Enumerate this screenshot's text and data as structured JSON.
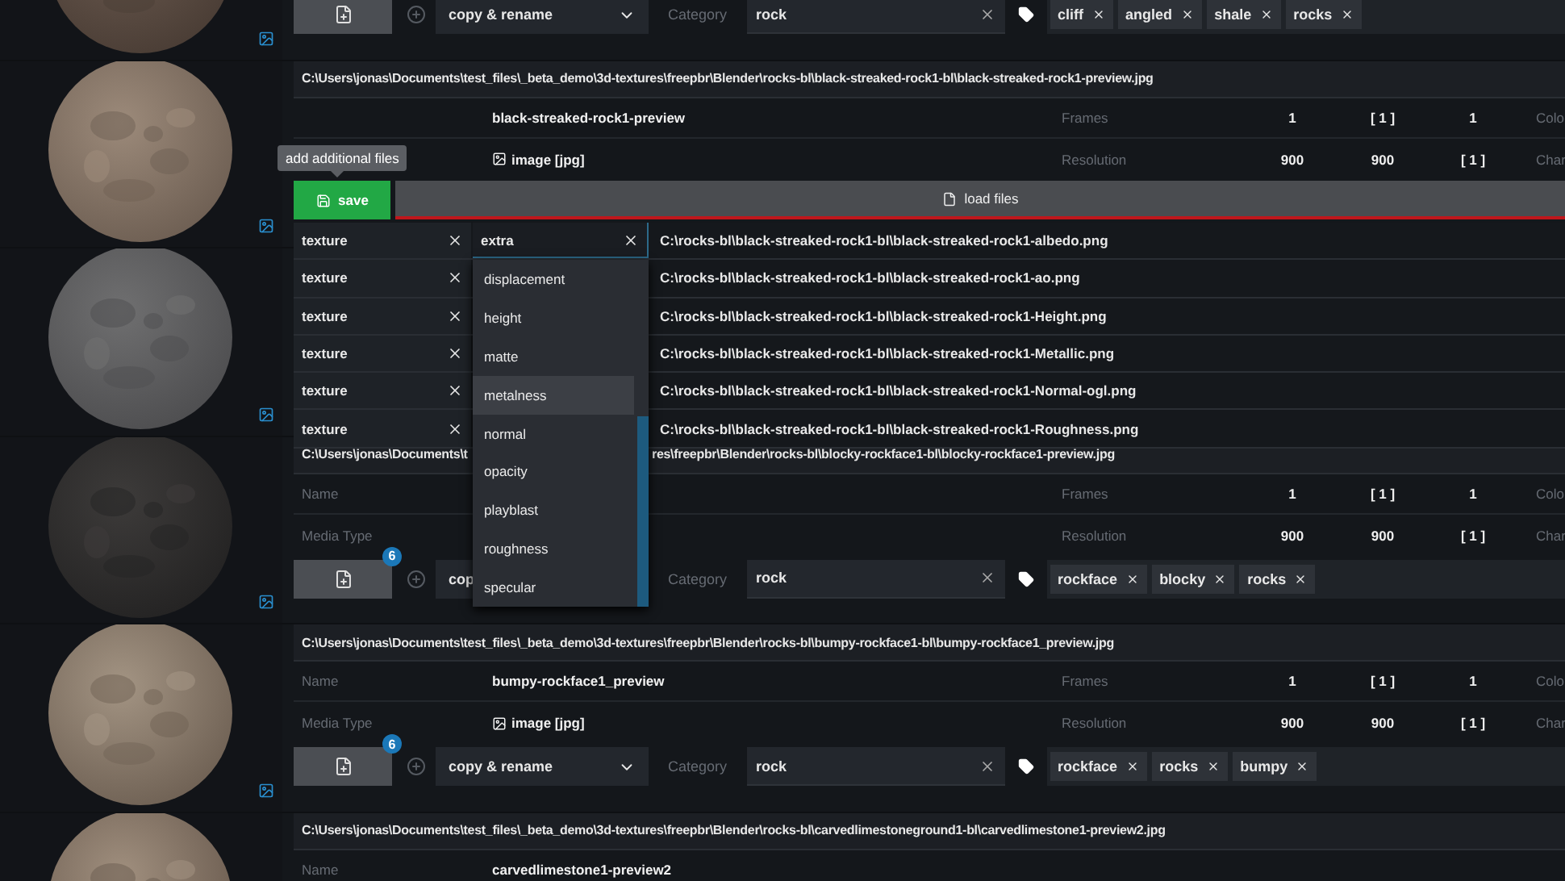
{
  "rows": [
    {
      "thumb_icon": true,
      "action_bar": {
        "mode": "copy & rename",
        "mode_chevron": true,
        "category_label": "Category",
        "category": "rock",
        "tags": [
          "cliff",
          "angled",
          "shale",
          "rocks"
        ]
      }
    },
    {
      "thumb_icon": true,
      "path": [
        "C:\\Users\\jonas\\Documents\\test_files\\_beta_demo\\3d-textures\\freepbr\\Blender\\rocks-bl\\black-streaked-rock1-bl\\black-streaked-rock1-preview.jpg"
      ],
      "name_value": "black-streaked-rock1-preview",
      "media_value": "image [jpg]",
      "frames_label": "Frames",
      "frames_values": [
        "1",
        "[ 1 ]",
        "1"
      ],
      "frames_extra": "Colo",
      "resolution_label": "Resolution",
      "resolution_values": [
        "900",
        "900",
        "[ 1 ]"
      ],
      "resolution_extra": "Char"
    },
    {
      "thumb_icon": true
    },
    {
      "thumb_icon": true,
      "path": [
        "C:\\Users\\jonas\\Documents\\t",
        "res\\freepbr\\Blender\\rocks-bl\\blocky-rockface1-bl\\blocky-rockface1-preview.jpg"
      ],
      "name_label": "Name",
      "media_label": "Media Type",
      "frames_label": "Frames",
      "frames_values": [
        "1",
        "[ 1 ]",
        "1"
      ],
      "frames_extra": "Colo",
      "resolution_label": "Resolution",
      "resolution_values": [
        "900",
        "900",
        "[ 1 ]"
      ],
      "resolution_extra": "Char",
      "action_bar": {
        "badge": "6",
        "mode": "cop",
        "category_label": "Category",
        "category": "rock",
        "tags": [
          "rockface",
          "blocky",
          "rocks"
        ]
      }
    },
    {
      "thumb_icon": true,
      "path": [
        "C:\\Users\\jonas\\Documents\\test_files\\_beta_demo\\3d-textures\\freepbr\\Blender\\rocks-bl\\bumpy-rockface1-bl\\bumpy-rockface1_preview.jpg"
      ],
      "name_label": "Name",
      "name_value": "bumpy-rockface1_preview",
      "media_label": "Media Type",
      "media_value": "image [jpg]",
      "frames_label": "Frames",
      "frames_values": [
        "1",
        "[ 1 ]",
        "1"
      ],
      "frames_extra": "Colo",
      "resolution_label": "Resolution",
      "resolution_values": [
        "900",
        "900",
        "[ 1 ]"
      ],
      "resolution_extra": "Char",
      "action_bar": {
        "badge": "6",
        "mode": "copy & rename",
        "mode_chevron": true,
        "category_label": "Category",
        "category": "rock",
        "tags": [
          "rockface",
          "rocks",
          "bumpy"
        ]
      }
    },
    {
      "path": [
        "C:\\Users\\jonas\\Documents\\test_files\\_beta_demo\\3d-textures\\freepbr\\Blender\\rocks-bl\\carvedlimestoneground1-bl\\carvedlimestone1-preview2.jpg"
      ],
      "name_label": "Name",
      "name_value": "carvedlimestone1-preview2"
    }
  ],
  "editor": {
    "tooltip": "add additional files",
    "save": "save",
    "load": "load files",
    "files": [
      {
        "role": "texture",
        "extra": "extra",
        "path": "C:\\rocks-bl\\black-streaked-rock1-bl\\black-streaked-rock1-albedo.png"
      },
      {
        "role": "texture",
        "path": "C:\\rocks-bl\\black-streaked-rock1-bl\\black-streaked-rock1-ao.png"
      },
      {
        "role": "texture",
        "path": "C:\\rocks-bl\\black-streaked-rock1-bl\\black-streaked-rock1-Height.png"
      },
      {
        "role": "texture",
        "path": "C:\\rocks-bl\\black-streaked-rock1-bl\\black-streaked-rock1-Metallic.png"
      },
      {
        "role": "texture",
        "path": "C:\\rocks-bl\\black-streaked-rock1-bl\\black-streaked-rock1-Normal-ogl.png"
      },
      {
        "role": "texture",
        "path": "C:\\rocks-bl\\black-streaked-rock1-bl\\black-streaked-rock1-Roughness.png"
      }
    ],
    "dropdown": [
      {
        "label": "displacement",
        "selected": false
      },
      {
        "label": "height",
        "selected": false
      },
      {
        "label": "matte",
        "selected": false
      },
      {
        "label": "metalness",
        "selected": true
      },
      {
        "label": "normal",
        "selected": false
      },
      {
        "label": "opacity",
        "selected": false
      },
      {
        "label": "playblast",
        "selected": false
      },
      {
        "label": "roughness",
        "selected": false
      },
      {
        "label": "specular",
        "selected": false
      }
    ]
  }
}
